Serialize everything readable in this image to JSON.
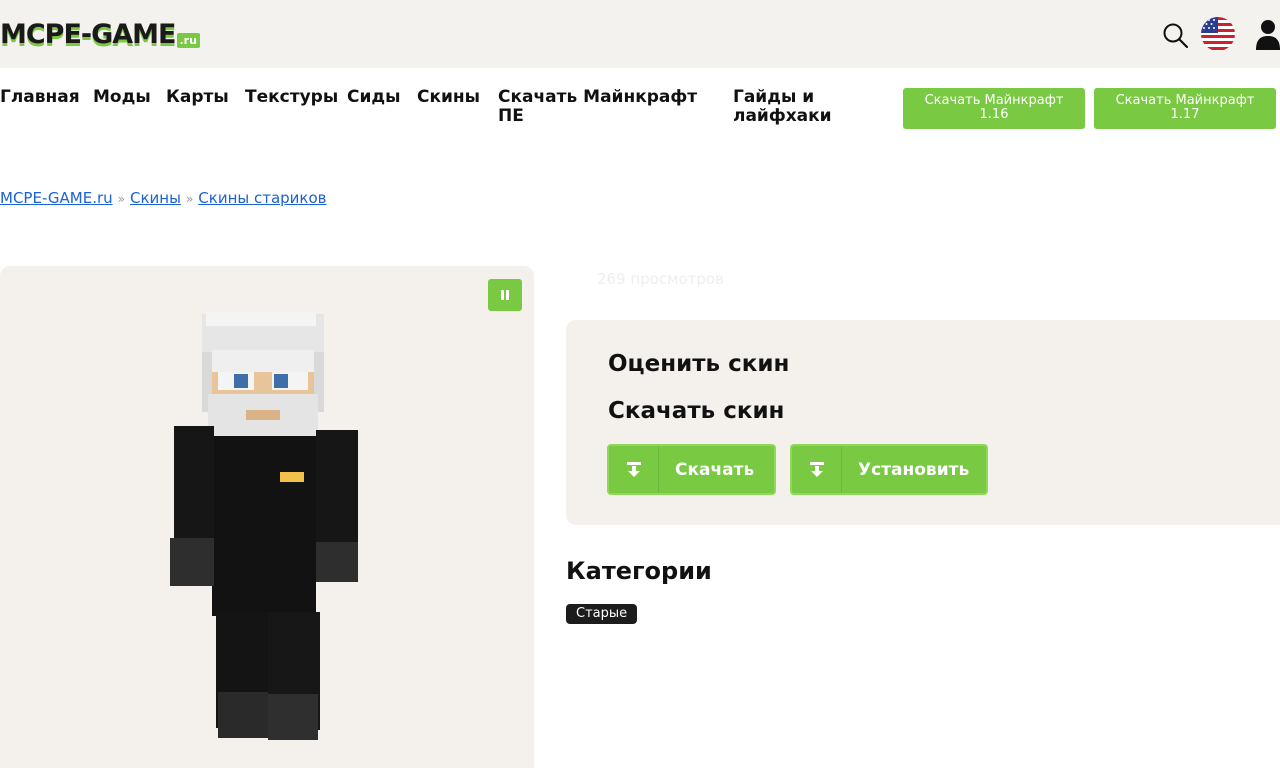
{
  "header": {
    "logo_text": "MCPE-GAME",
    "logo_suffix": ".ru"
  },
  "nav": {
    "items": [
      "Главная",
      "Моды",
      "Карты",
      "Текстуры",
      "Сиды",
      "Скины",
      "Скачать Майнкрафт ПЕ",
      "Гайды и лайфхаки"
    ],
    "download_buttons": [
      {
        "label": "Скачать Майнкрафт",
        "version": "1.16"
      },
      {
        "label": "Скачать Майнкрафт",
        "version": "1.17"
      }
    ]
  },
  "breadcrumb": {
    "items": [
      "MCPE-GAME.ru",
      "Скины",
      "Скины стариков"
    ],
    "separator": "»"
  },
  "skin": {
    "views": "269 просмотров"
  },
  "actions": {
    "rate_title": "Оценить скин",
    "download_title": "Скачать скин",
    "download_label": "Скачать",
    "install_label": "Установить"
  },
  "categories": {
    "title": "Категории",
    "tags": [
      "Старые"
    ]
  },
  "colors": {
    "accent": "#7ac943",
    "panel": "#f4f1ec",
    "link": "#1a62d6"
  }
}
